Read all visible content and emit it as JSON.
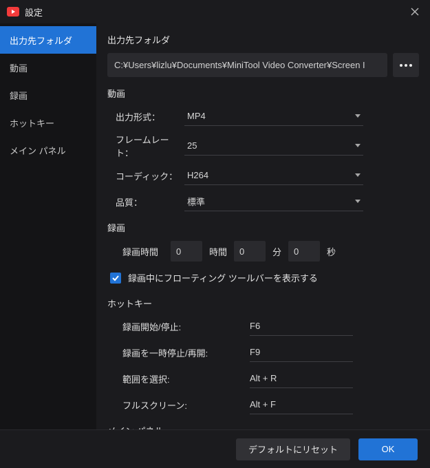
{
  "window": {
    "title": "設定"
  },
  "sidebar": {
    "items": [
      {
        "label": "出力先フォルダ",
        "active": true
      },
      {
        "label": "動画",
        "active": false
      },
      {
        "label": "録画",
        "active": false
      },
      {
        "label": "ホットキー",
        "active": false
      },
      {
        "label": "メイン パネル",
        "active": false
      }
    ]
  },
  "output_folder": {
    "title": "出力先フォルダ",
    "path": "C:¥Users¥lizlu¥Documents¥MiniTool Video Converter¥Screen I"
  },
  "video": {
    "title": "動画",
    "format_label": "出力形式：",
    "format_value": "MP4",
    "framerate_label": "フレームレート：",
    "framerate_value": "25",
    "codec_label": "コーディック：",
    "codec_value": "H264",
    "quality_label": "品質：",
    "quality_value": "標準"
  },
  "record": {
    "title": "録画",
    "time_label": "録画時間",
    "hours_value": "0",
    "hours_unit": "時間",
    "minutes_value": "0",
    "minutes_unit": "分",
    "seconds_value": "0",
    "seconds_unit": "秒",
    "show_toolbar_label": "録画中にフローティング ツールバーを表示する",
    "show_toolbar_checked": true
  },
  "hotkeys": {
    "title": "ホットキー",
    "items": [
      {
        "label": "録画開始/停止:",
        "value": "F6"
      },
      {
        "label": "録画を一時停止/再開:",
        "value": "F9"
      },
      {
        "label": "範囲を選択:",
        "value": "Alt + R"
      },
      {
        "label": "フルスクリーン:",
        "value": "Alt + F"
      }
    ]
  },
  "main_panel": {
    "title": "メイン パネル"
  },
  "footer": {
    "reset_label": "デフォルトにリセット",
    "ok_label": "OK"
  }
}
